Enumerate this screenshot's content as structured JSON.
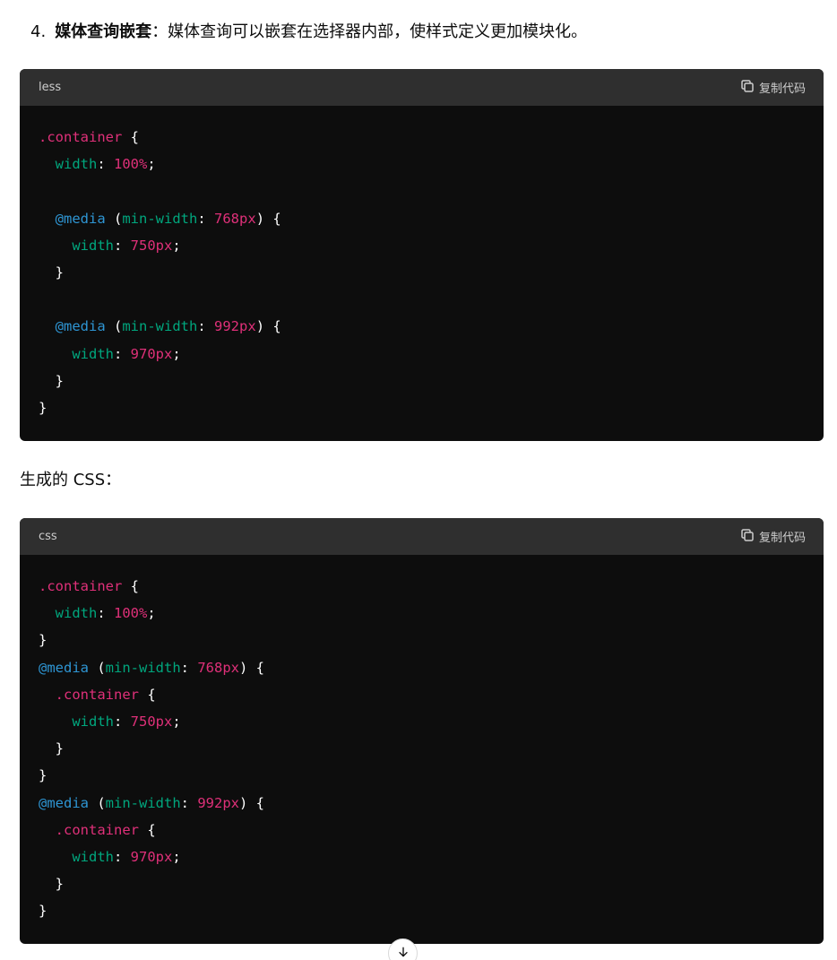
{
  "list_item": {
    "number": "4.",
    "title": "媒体查询嵌套",
    "description": "：媒体查询可以嵌套在选择器内部，使样式定义更加模块化。"
  },
  "code_blocks": [
    {
      "language": "less",
      "copy_label": "复制代码",
      "lines": [
        [
          {
            "t": "sel",
            "v": ".container"
          },
          {
            "t": "pun",
            "v": " {"
          }
        ],
        [
          {
            "t": "pun",
            "v": "  "
          },
          {
            "t": "prop",
            "v": "width"
          },
          {
            "t": "pun",
            "v": ": "
          },
          {
            "t": "num-v",
            "v": "100%"
          },
          {
            "t": "pun",
            "v": ";"
          }
        ],
        [],
        [
          {
            "t": "pun",
            "v": "  "
          },
          {
            "t": "at",
            "v": "@media"
          },
          {
            "t": "pun",
            "v": " ("
          },
          {
            "t": "prop",
            "v": "min-width"
          },
          {
            "t": "pun",
            "v": ": "
          },
          {
            "t": "num-v",
            "v": "768px"
          },
          {
            "t": "pun",
            "v": ") {"
          }
        ],
        [
          {
            "t": "pun",
            "v": "    "
          },
          {
            "t": "prop",
            "v": "width"
          },
          {
            "t": "pun",
            "v": ": "
          },
          {
            "t": "num-v",
            "v": "750px"
          },
          {
            "t": "pun",
            "v": ";"
          }
        ],
        [
          {
            "t": "pun",
            "v": "  }"
          }
        ],
        [],
        [
          {
            "t": "pun",
            "v": "  "
          },
          {
            "t": "at",
            "v": "@media"
          },
          {
            "t": "pun",
            "v": " ("
          },
          {
            "t": "prop",
            "v": "min-width"
          },
          {
            "t": "pun",
            "v": ": "
          },
          {
            "t": "num-v",
            "v": "992px"
          },
          {
            "t": "pun",
            "v": ") {"
          }
        ],
        [
          {
            "t": "pun",
            "v": "    "
          },
          {
            "t": "prop",
            "v": "width"
          },
          {
            "t": "pun",
            "v": ": "
          },
          {
            "t": "num-v",
            "v": "970px"
          },
          {
            "t": "pun",
            "v": ";"
          }
        ],
        [
          {
            "t": "pun",
            "v": "  }"
          }
        ],
        [
          {
            "t": "pun",
            "v": "}"
          }
        ]
      ]
    },
    {
      "language": "css",
      "copy_label": "复制代码",
      "lines": [
        [
          {
            "t": "sel",
            "v": ".container"
          },
          {
            "t": "pun",
            "v": " {"
          }
        ],
        [
          {
            "t": "pun",
            "v": "  "
          },
          {
            "t": "prop",
            "v": "width"
          },
          {
            "t": "pun",
            "v": ": "
          },
          {
            "t": "num-v",
            "v": "100%"
          },
          {
            "t": "pun",
            "v": ";"
          }
        ],
        [
          {
            "t": "pun",
            "v": "}"
          }
        ],
        [
          {
            "t": "at",
            "v": "@media"
          },
          {
            "t": "pun",
            "v": " ("
          },
          {
            "t": "prop",
            "v": "min-width"
          },
          {
            "t": "pun",
            "v": ": "
          },
          {
            "t": "num-v",
            "v": "768px"
          },
          {
            "t": "pun",
            "v": ") {"
          }
        ],
        [
          {
            "t": "pun",
            "v": "  "
          },
          {
            "t": "sel",
            "v": ".container"
          },
          {
            "t": "pun",
            "v": " {"
          }
        ],
        [
          {
            "t": "pun",
            "v": "    "
          },
          {
            "t": "prop",
            "v": "width"
          },
          {
            "t": "pun",
            "v": ": "
          },
          {
            "t": "num-v",
            "v": "750px"
          },
          {
            "t": "pun",
            "v": ";"
          }
        ],
        [
          {
            "t": "pun",
            "v": "  }"
          }
        ],
        [
          {
            "t": "pun",
            "v": "}"
          }
        ],
        [
          {
            "t": "at",
            "v": "@media"
          },
          {
            "t": "pun",
            "v": " ("
          },
          {
            "t": "prop",
            "v": "min-width"
          },
          {
            "t": "pun",
            "v": ": "
          },
          {
            "t": "num-v",
            "v": "992px"
          },
          {
            "t": "pun",
            "v": ") {"
          }
        ],
        [
          {
            "t": "pun",
            "v": "  "
          },
          {
            "t": "sel",
            "v": ".container"
          },
          {
            "t": "pun",
            "v": " {"
          }
        ],
        [
          {
            "t": "pun",
            "v": "    "
          },
          {
            "t": "prop",
            "v": "width"
          },
          {
            "t": "pun",
            "v": ": "
          },
          {
            "t": "num-v",
            "v": "970px"
          },
          {
            "t": "pun",
            "v": ";"
          }
        ],
        [
          {
            "t": "pun",
            "v": "  }"
          }
        ],
        [
          {
            "t": "pun",
            "v": "}"
          }
        ]
      ]
    }
  ],
  "paragraph": "生成的 CSS：",
  "icons": {
    "copy": "copy-icon",
    "scroll": "arrow-down-icon"
  },
  "colors": {
    "code_bg": "#0d0d0d",
    "header_bg": "#2f2f2f",
    "selector": "#df3079",
    "property": "#00a67d",
    "number": "#df3079",
    "at_rule": "#2e95d3"
  }
}
